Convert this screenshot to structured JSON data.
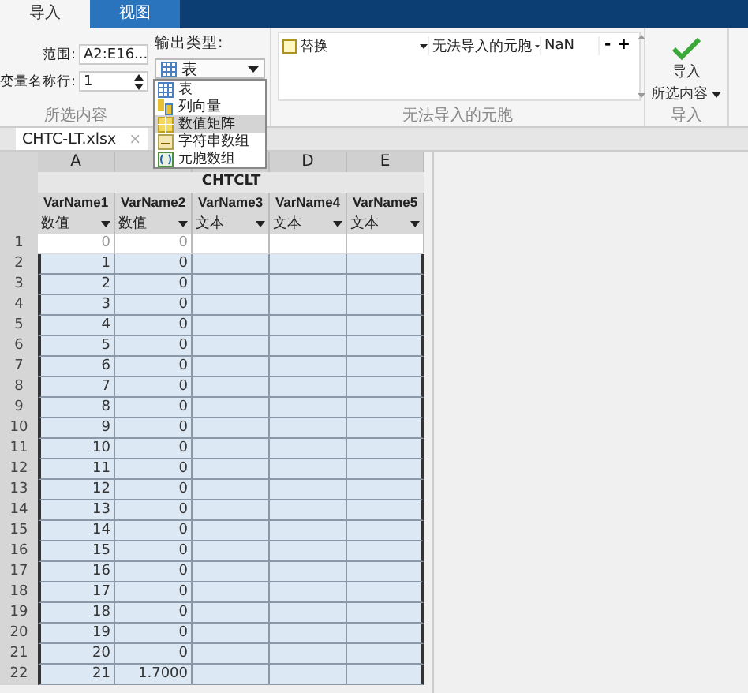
{
  "tabs": [
    {
      "label": "导入",
      "selected": true
    },
    {
      "label": "视图",
      "selected": false
    }
  ],
  "ribbon": {
    "selection": {
      "range_label": "范围:",
      "range_value": "A2:E16...",
      "header_row_label": "变量名称行:",
      "header_row_value": "1",
      "output_type_label": "输出类型:",
      "output_type_value": "表",
      "section_label": "所选内容"
    },
    "unimportable": {
      "rule": "替换",
      "condition": "无法导入的元胞",
      "replacement": "NaN",
      "minus": "-",
      "plus": "+",
      "section_label": "无法导入的元胞"
    },
    "import": {
      "line1": "导入",
      "line2": "所选内容",
      "section_label": "导入"
    }
  },
  "output_type_menu": [
    {
      "label": "表",
      "kind": "table",
      "selected": false
    },
    {
      "label": "列向量",
      "kind": "vector",
      "selected": false
    },
    {
      "label": "数值矩阵",
      "kind": "matrix",
      "selected": true
    },
    {
      "label": "字符串数组",
      "kind": "string",
      "selected": false
    },
    {
      "label": "元胞数组",
      "kind": "cell",
      "selected": false
    }
  ],
  "file_tab": {
    "label": "CHTC-LT.xlsx",
    "close": "×"
  },
  "sheet": {
    "title": "CHTCLT",
    "columns": [
      {
        "letter": "A",
        "name": "VarName1",
        "type": "数值"
      },
      {
        "name": "VarName2",
        "type": "数值"
      },
      {
        "name": "VarName3",
        "type": "文本"
      },
      {
        "letter": "D",
        "name": "VarName4",
        "type": "文本"
      },
      {
        "letter": "E",
        "name": "VarName5",
        "type": "文本"
      }
    ],
    "rows": [
      {
        "num": "1",
        "cells": [
          "0",
          "0"
        ],
        "selected": false
      },
      {
        "num": "2",
        "cells": [
          "1",
          "0"
        ],
        "selected": true
      },
      {
        "num": "3",
        "cells": [
          "2",
          "0"
        ],
        "selected": true
      },
      {
        "num": "4",
        "cells": [
          "3",
          "0"
        ],
        "selected": true
      },
      {
        "num": "5",
        "cells": [
          "4",
          "0"
        ],
        "selected": true
      },
      {
        "num": "6",
        "cells": [
          "5",
          "0"
        ],
        "selected": true
      },
      {
        "num": "7",
        "cells": [
          "6",
          "0"
        ],
        "selected": true
      },
      {
        "num": "8",
        "cells": [
          "7",
          "0"
        ],
        "selected": true
      },
      {
        "num": "9",
        "cells": [
          "8",
          "0"
        ],
        "selected": true
      },
      {
        "num": "10",
        "cells": [
          "9",
          "0"
        ],
        "selected": true
      },
      {
        "num": "11",
        "cells": [
          "10",
          "0"
        ],
        "selected": true
      },
      {
        "num": "12",
        "cells": [
          "11",
          "0"
        ],
        "selected": true
      },
      {
        "num": "13",
        "cells": [
          "12",
          "0"
        ],
        "selected": true
      },
      {
        "num": "14",
        "cells": [
          "13",
          "0"
        ],
        "selected": true
      },
      {
        "num": "15",
        "cells": [
          "14",
          "0"
        ],
        "selected": true
      },
      {
        "num": "16",
        "cells": [
          "15",
          "0"
        ],
        "selected": true
      },
      {
        "num": "17",
        "cells": [
          "16",
          "0"
        ],
        "selected": true
      },
      {
        "num": "18",
        "cells": [
          "17",
          "0"
        ],
        "selected": true
      },
      {
        "num": "19",
        "cells": [
          "18",
          "0"
        ],
        "selected": true
      },
      {
        "num": "20",
        "cells": [
          "19",
          "0"
        ],
        "selected": true
      },
      {
        "num": "21",
        "cells": [
          "20",
          "0"
        ],
        "selected": true
      },
      {
        "num": "22",
        "cells": [
          "21",
          "1.7000"
        ],
        "selected": true
      }
    ]
  }
}
